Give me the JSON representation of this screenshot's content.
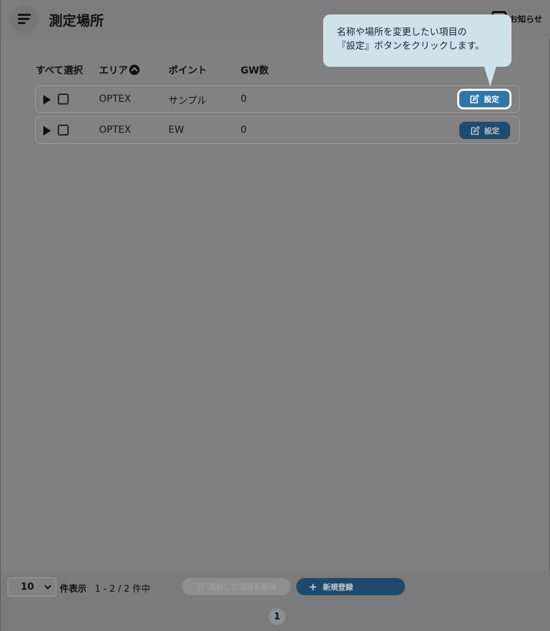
{
  "header": {
    "title": "測定場所",
    "menu_icon": "hamburger-icon",
    "notice_label": "お知らせ"
  },
  "tooltip": {
    "line1": "名称や場所を変更したい項目の",
    "line2": "『設定』ボタンをクリックします。"
  },
  "table": {
    "columns": {
      "select_all": "すべて選択",
      "area": "エリア",
      "point": "ポイント",
      "gw_count": "GW数"
    },
    "rows": [
      {
        "area": "OPTEX",
        "point": "サンプル",
        "gw": "0",
        "action": "設定"
      },
      {
        "area": "OPTEX",
        "point": "EW",
        "gw": "0",
        "action": "設定"
      }
    ]
  },
  "footer": {
    "per_page_value": "10",
    "per_page_label": "件表示",
    "range": "1 - 2 / 2 件中",
    "delete_label": "選択した項目を削除",
    "new_label": "新規登録",
    "current_page": "1"
  },
  "colors": {
    "overlay": "#808080",
    "accent": "#2f77a6",
    "button_dark": "#1c4c6f",
    "tooltip_bg": "#cee2ea"
  }
}
